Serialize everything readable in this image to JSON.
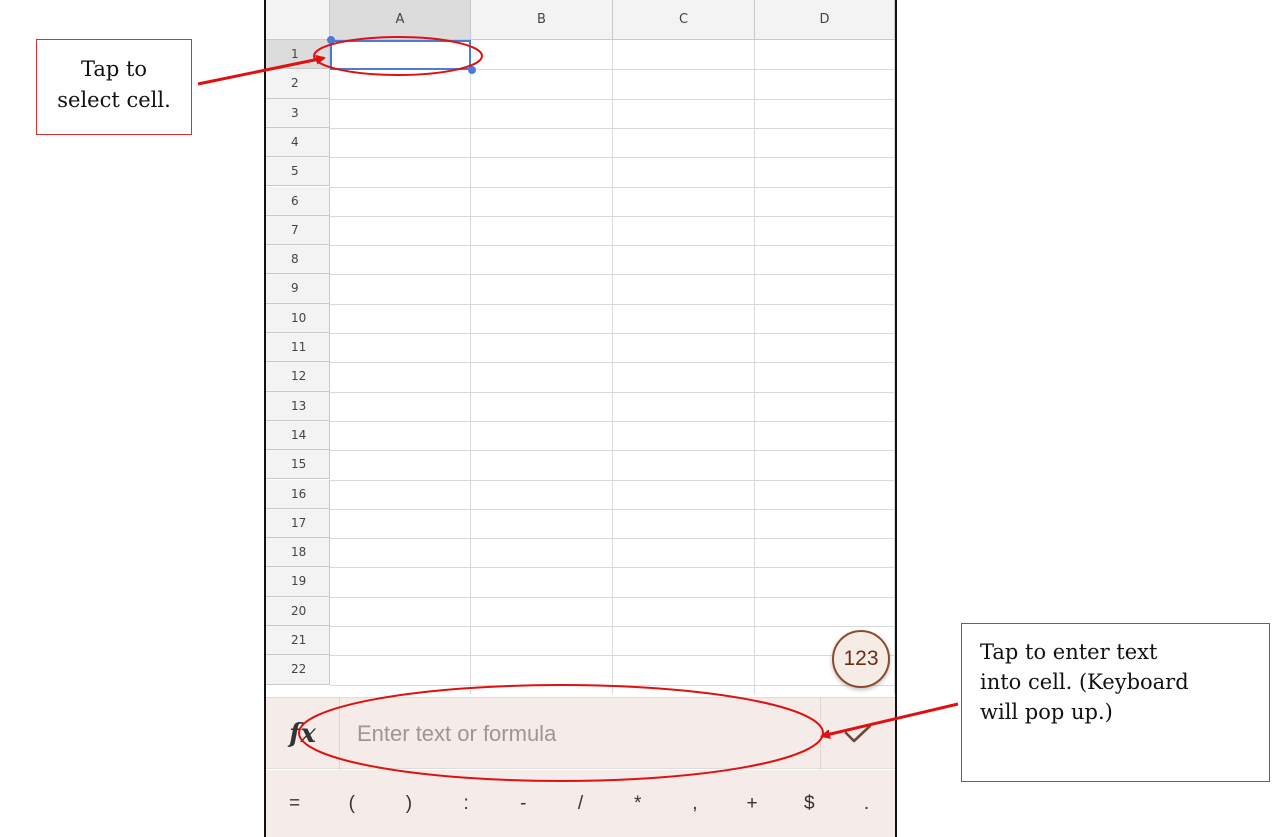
{
  "spreadsheet": {
    "columns": [
      "A",
      "B",
      "C",
      "D"
    ],
    "rows": [
      "1",
      "2",
      "3",
      "4",
      "5",
      "6",
      "7",
      "8",
      "9",
      "10",
      "11",
      "12",
      "13",
      "14",
      "15",
      "16",
      "17",
      "18",
      "19",
      "20",
      "21",
      "22"
    ],
    "selected_cell": "A1"
  },
  "fab": {
    "label": "123"
  },
  "formula_bar": {
    "fx_label": "fx",
    "placeholder": "Enter text or formula"
  },
  "symbol_bar": {
    "keys": [
      "=",
      "(",
      ")",
      ":",
      "-",
      "/",
      "*",
      ",",
      "+",
      "$",
      "."
    ]
  },
  "annotations": {
    "left": [
      "Tap to",
      "select cell."
    ],
    "right": [
      "Tap to enter text",
      "into cell. (Keyboard",
      "will pop up.)"
    ]
  },
  "colors": {
    "annotation_red": "#e01010",
    "selection_blue": "#4a7bd6",
    "bar_background": "#f5ebe8",
    "fab_border": "#8b4a2a"
  }
}
